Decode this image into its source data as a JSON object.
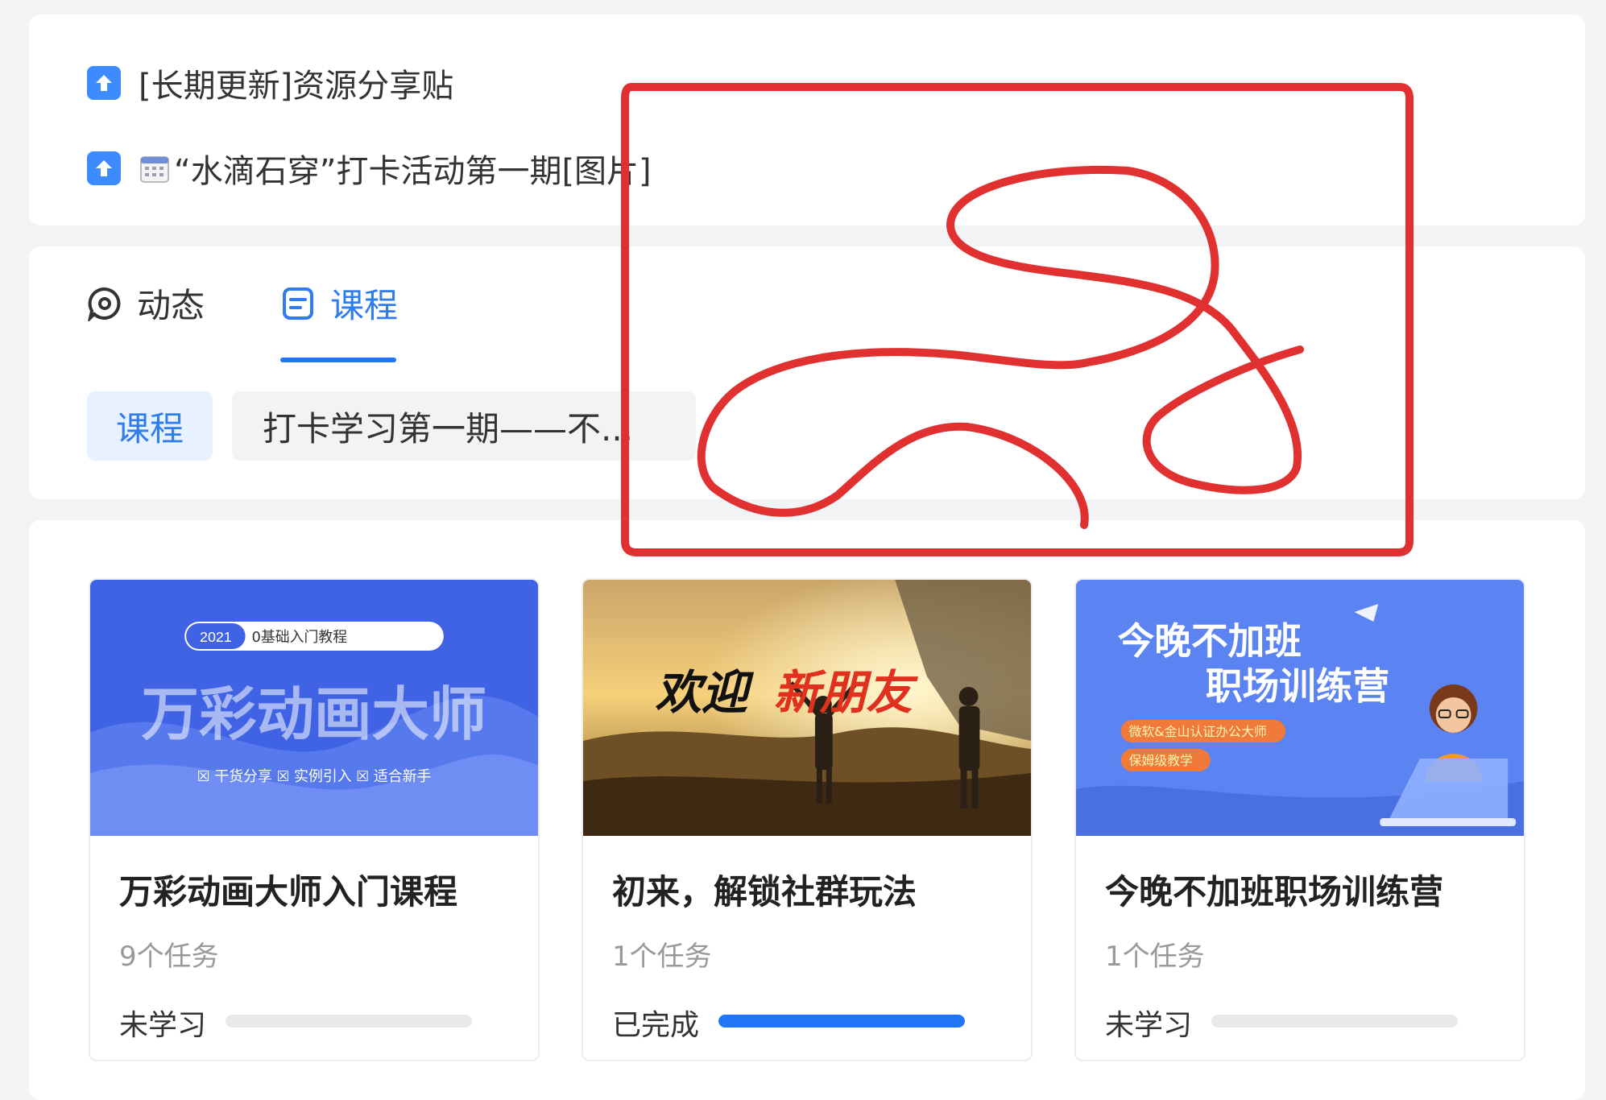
{
  "pinned_posts": [
    {
      "title": "[长期更新]资源分享贴"
    },
    {
      "title": "“水滴石穿”打卡活动第一期[图片]"
    }
  ],
  "tabs": [
    {
      "label": "动态",
      "active": false
    },
    {
      "label": "课程",
      "active": true
    }
  ],
  "filters": [
    {
      "label": "课程",
      "active": true
    },
    {
      "label": "打卡学习第一期——不...",
      "active": false
    }
  ],
  "courses": [
    {
      "title": "万彩动画大师入门课程",
      "tasks": "9个任务",
      "status": "未学习",
      "progress": 0,
      "cover": {
        "badge_year": "2021",
        "badge_text": "0基础入门教程",
        "headline": "万彩动画大师",
        "tags": "☒ 干货分享   ☒ 实例引入   ☒ 适合新手"
      }
    },
    {
      "title": "初来，解锁社群玩法",
      "tasks": "1个任务",
      "status": "已完成",
      "progress": 1,
      "cover": {
        "headline_black": "欢迎",
        "headline_red": "新朋友"
      }
    },
    {
      "title": "今晚不加班职场训练营",
      "tasks": "1个任务",
      "status": "未学习",
      "progress": 0,
      "cover": {
        "line1": "今晚不加班",
        "line2": "职场训练营",
        "tag1": "微软&金山认证办公大师",
        "tag2": "保姆级教学"
      }
    }
  ],
  "colors": {
    "accent": "#1f75f5",
    "annotation": "#e03030"
  }
}
